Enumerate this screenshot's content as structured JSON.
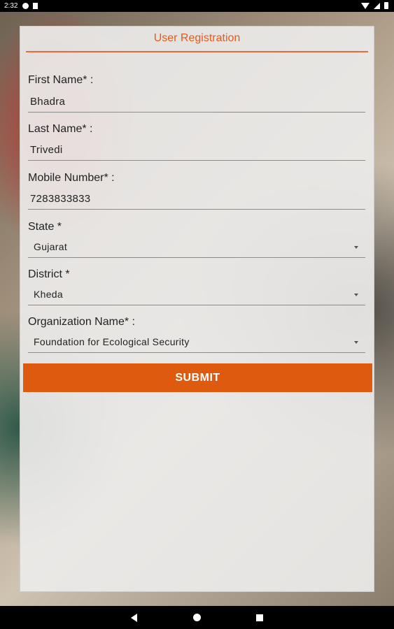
{
  "status_bar": {
    "time": "2:32",
    "icons": [
      "notification-icon",
      "sim-icon",
      "wifi-icon",
      "signal-icon",
      "battery-icon"
    ]
  },
  "form": {
    "title": "User Registration",
    "first_name": {
      "label": "First Name* :",
      "value": "Bhadra"
    },
    "last_name": {
      "label": "Last Name* :",
      "value": "Trivedi"
    },
    "mobile": {
      "label": "Mobile Number* :",
      "value": "7283833833"
    },
    "state": {
      "label": "State *",
      "value": "Gujarat"
    },
    "district": {
      "label": "District *",
      "value": "Kheda"
    },
    "organization": {
      "label": "Organization Name* :",
      "value": "Foundation for Ecological Security"
    },
    "submit_label": "SUBMIT"
  },
  "colors": {
    "accent": "#dd5a0e",
    "title": "#e55a1c"
  },
  "nav_bar": {
    "icons": [
      "back-icon",
      "home-icon",
      "recents-icon"
    ]
  }
}
